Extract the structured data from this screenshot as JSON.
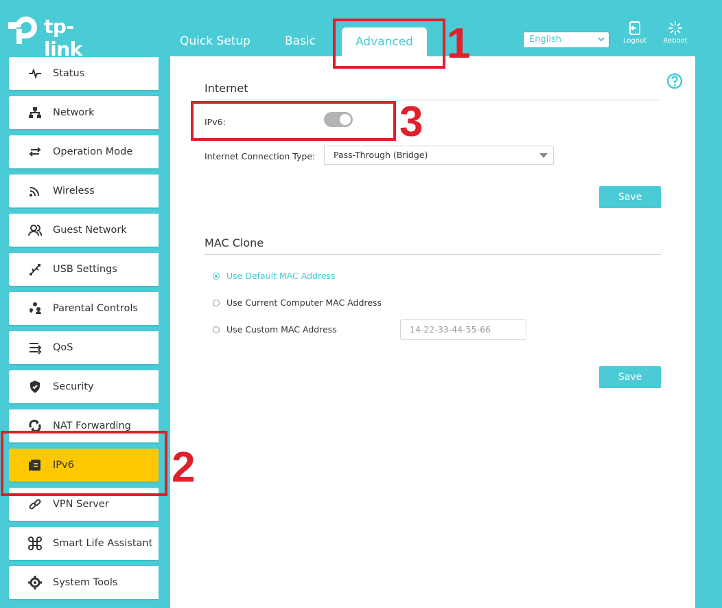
{
  "brand": {
    "name": "tp-link"
  },
  "top_tabs": [
    {
      "label": "Quick Setup"
    },
    {
      "label": "Basic"
    },
    {
      "label": "Advanced",
      "active": true
    }
  ],
  "header": {
    "language": "English",
    "logout_label": "Logout",
    "reboot_label": "Reboot"
  },
  "sidebar": {
    "items": [
      {
        "label": "Status",
        "icon": "pulse-icon"
      },
      {
        "label": "Network",
        "icon": "network-icon"
      },
      {
        "label": "Operation Mode",
        "icon": "operation-mode-icon"
      },
      {
        "label": "Wireless",
        "icon": "wifi-icon"
      },
      {
        "label": "Guest Network",
        "icon": "guest-icon"
      },
      {
        "label": "USB Settings",
        "icon": "usb-icon"
      },
      {
        "label": "Parental Controls",
        "icon": "parental-icon"
      },
      {
        "label": "QoS",
        "icon": "qos-icon"
      },
      {
        "label": "Security",
        "icon": "shield-icon"
      },
      {
        "label": "NAT Forwarding",
        "icon": "nat-icon"
      },
      {
        "label": "IPv6",
        "icon": "ipv6-icon",
        "active": true
      },
      {
        "label": "VPN Server",
        "icon": "link-icon"
      },
      {
        "label": "Smart Life Assistant",
        "icon": "command-icon"
      },
      {
        "label": "System Tools",
        "icon": "gear-icon"
      }
    ]
  },
  "internet": {
    "title": "Internet",
    "ipv6_label": "IPv6:",
    "ipv6_enabled": false,
    "conn_type_label": "Internet Connection Type:",
    "conn_type_value": "Pass-Through (Bridge)",
    "save_label": "Save"
  },
  "mac_clone": {
    "title": "MAC Clone",
    "options": [
      {
        "label": "Use Default MAC Address",
        "selected": true
      },
      {
        "label": "Use Current Computer MAC Address",
        "selected": false
      },
      {
        "label": "Use Custom MAC Address",
        "selected": false
      }
    ],
    "custom_placeholder": "14-22-33-44-55-66",
    "save_label": "Save"
  },
  "annotations": [
    "1",
    "2",
    "3"
  ],
  "colors": {
    "accent": "#4acbd6",
    "active_item": "#fdc800",
    "annotation": "#e0202a"
  }
}
